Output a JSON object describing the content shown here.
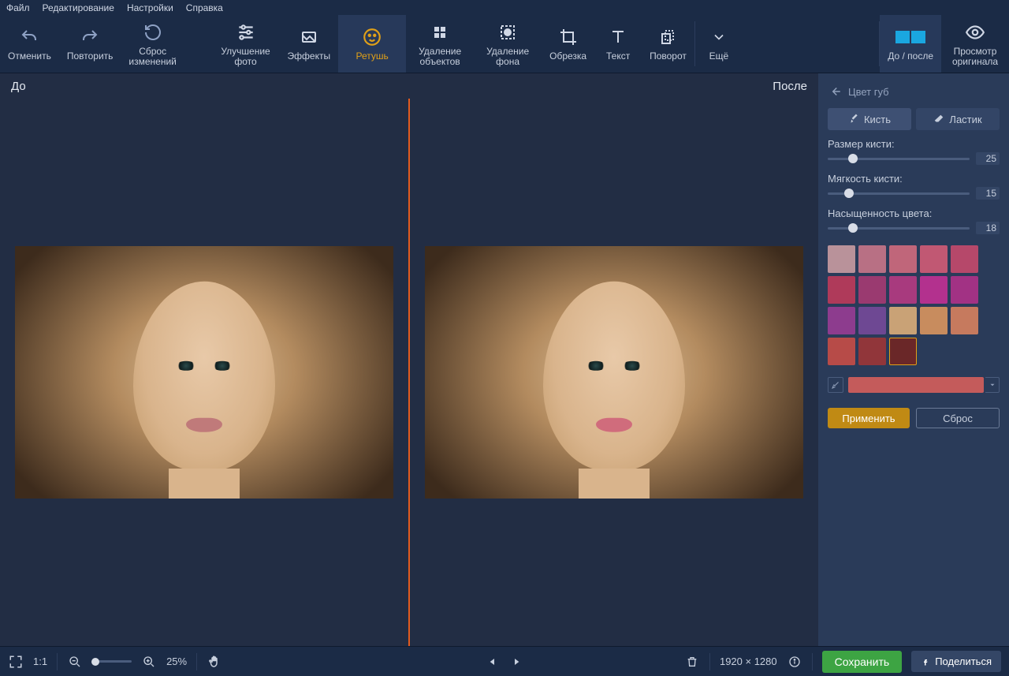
{
  "menu": [
    "Файл",
    "Редактирование",
    "Настройки",
    "Справка"
  ],
  "toolbar": {
    "undo": "Отменить",
    "redo": "Повторить",
    "reset": "Сброс\nизменений",
    "enhance": "Улучшение\nфото",
    "effects": "Эффекты",
    "retouch": "Ретушь",
    "remove_objects": "Удаление\nобъектов",
    "remove_bg": "Удаление\nфона",
    "crop": "Обрезка",
    "text": "Текст",
    "rotate": "Поворот",
    "more": "Ещё",
    "before_after": "До / после",
    "view_original": "Просмотр\nоригинала"
  },
  "canvas": {
    "before": "До",
    "after": "После"
  },
  "panel": {
    "title": "Цвет губ",
    "brush": "Кисть",
    "eraser": "Ластик",
    "size_label": "Размер кисти:",
    "size_value": "25",
    "soft_label": "Мягкость кисти:",
    "soft_value": "15",
    "sat_label": "Насыщенность цвета:",
    "sat_value": "18",
    "apply": "Применить",
    "cancel": "Сброс"
  },
  "swatches": [
    "#b9929a",
    "#b87084",
    "#c0667a",
    "#c15873",
    "#b6486a",
    "#af3a5a",
    "#9a3a70",
    "#a83a7e",
    "#b3318e",
    "#a23284",
    "#8d3c8e",
    "#6e4893",
    "#c9a276",
    "#c88c5e",
    "#c67a5e",
    "#b74b48",
    "#91363a",
    "#6a2728"
  ],
  "custom_color": "#c45b5b",
  "bottom": {
    "fit": "1:1",
    "zoom": "25%",
    "dims": "1920 × 1280",
    "save": "Сохранить",
    "share": "Поделиться"
  }
}
